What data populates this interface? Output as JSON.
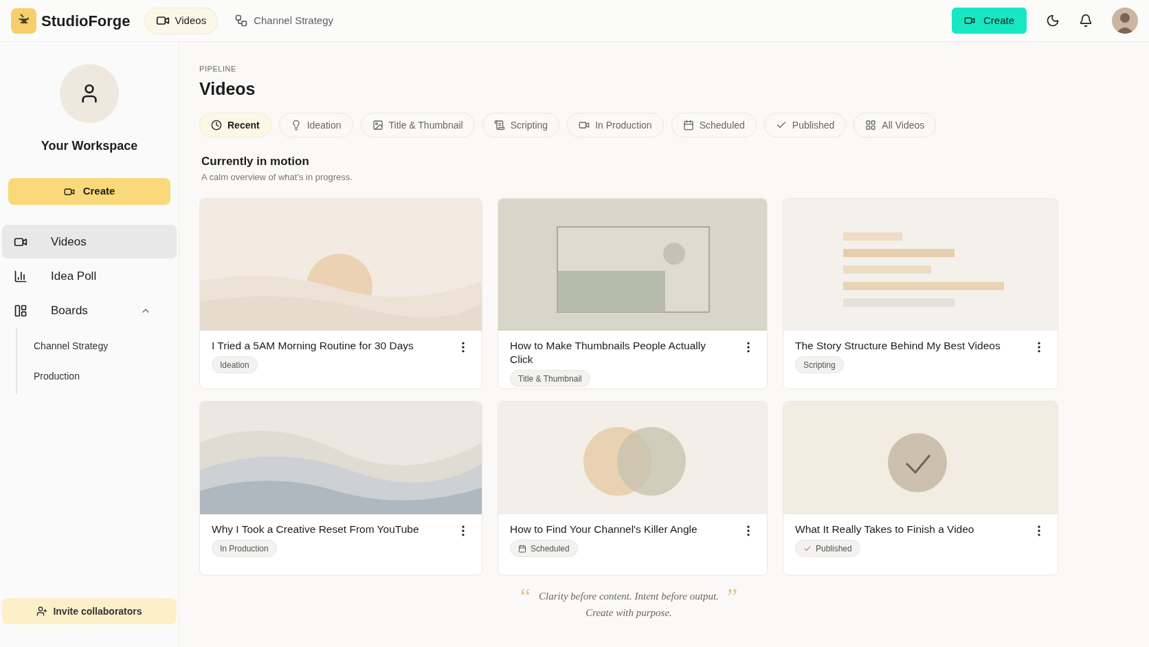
{
  "brand": {
    "name": "StudioForge"
  },
  "top_nav": [
    {
      "label": "Videos",
      "kind": "video",
      "selected": true
    },
    {
      "label": "Channel Strategy",
      "kind": "flow",
      "selected": false
    }
  ],
  "header_actions": {
    "create": "Create"
  },
  "sidebar": {
    "workspace": "Your Workspace",
    "create": "Create",
    "items": [
      {
        "label": "Videos",
        "kind": "video",
        "selected": true
      },
      {
        "label": "Idea Poll",
        "kind": "poll",
        "selected": false
      },
      {
        "label": "Boards",
        "kind": "boards",
        "selected": false,
        "expanded": true,
        "children": [
          {
            "label": "Channel Strategy"
          },
          {
            "label": "Production"
          }
        ]
      }
    ],
    "invite": "Invite collaborators"
  },
  "page": {
    "eyebrow": "PIPELINE",
    "title": "Videos"
  },
  "filters": [
    {
      "label": "Recent",
      "kind": "clock",
      "selected": true
    },
    {
      "label": "Ideation",
      "kind": "bulb",
      "selected": false
    },
    {
      "label": "Title & Thumbnail",
      "kind": "image",
      "selected": false
    },
    {
      "label": "Scripting",
      "kind": "script",
      "selected": false
    },
    {
      "label": "In Production",
      "kind": "video",
      "selected": false
    },
    {
      "label": "Scheduled",
      "kind": "calendar",
      "selected": false
    },
    {
      "label": "Published",
      "kind": "check",
      "selected": false
    },
    {
      "label": "All Videos",
      "kind": "grid",
      "selected": false
    }
  ],
  "section": {
    "title": "Currently in motion",
    "subtitle": "A calm overview of what's in progress."
  },
  "cards": [
    {
      "title": "I Tried a 5AM Morning Routine for 30 Days",
      "stage": {
        "label": "Ideation",
        "kind": "plain"
      },
      "thumb": {
        "kind": "sun"
      }
    },
    {
      "title": "How to Make Thumbnails People Actually Click",
      "stage": {
        "label": "Title & Thumbnail",
        "kind": "plain"
      },
      "thumb": {
        "kind": "frame"
      }
    },
    {
      "title": "The Story Structure Behind My Best Videos",
      "stage": {
        "label": "Scripting",
        "kind": "plain"
      },
      "thumb": {
        "kind": "lines"
      }
    },
    {
      "title": "Why I Took a Creative Reset From YouTube",
      "stage": {
        "label": "In Production",
        "kind": "plain"
      },
      "thumb": {
        "kind": "waves"
      }
    },
    {
      "title": "How to Find Your Channel's Killer Angle",
      "stage": {
        "label": "Scheduled",
        "kind": "calendar"
      },
      "thumb": {
        "kind": "venn"
      }
    },
    {
      "title": "What It Really Takes to Finish a Video",
      "stage": {
        "label": "Published",
        "kind": "check"
      },
      "thumb": {
        "kind": "check"
      }
    }
  ],
  "quote": {
    "open": "“",
    "line1": "Clarity before content. Intent before output.",
    "line2": "Create with purpose.",
    "close": "”"
  }
}
